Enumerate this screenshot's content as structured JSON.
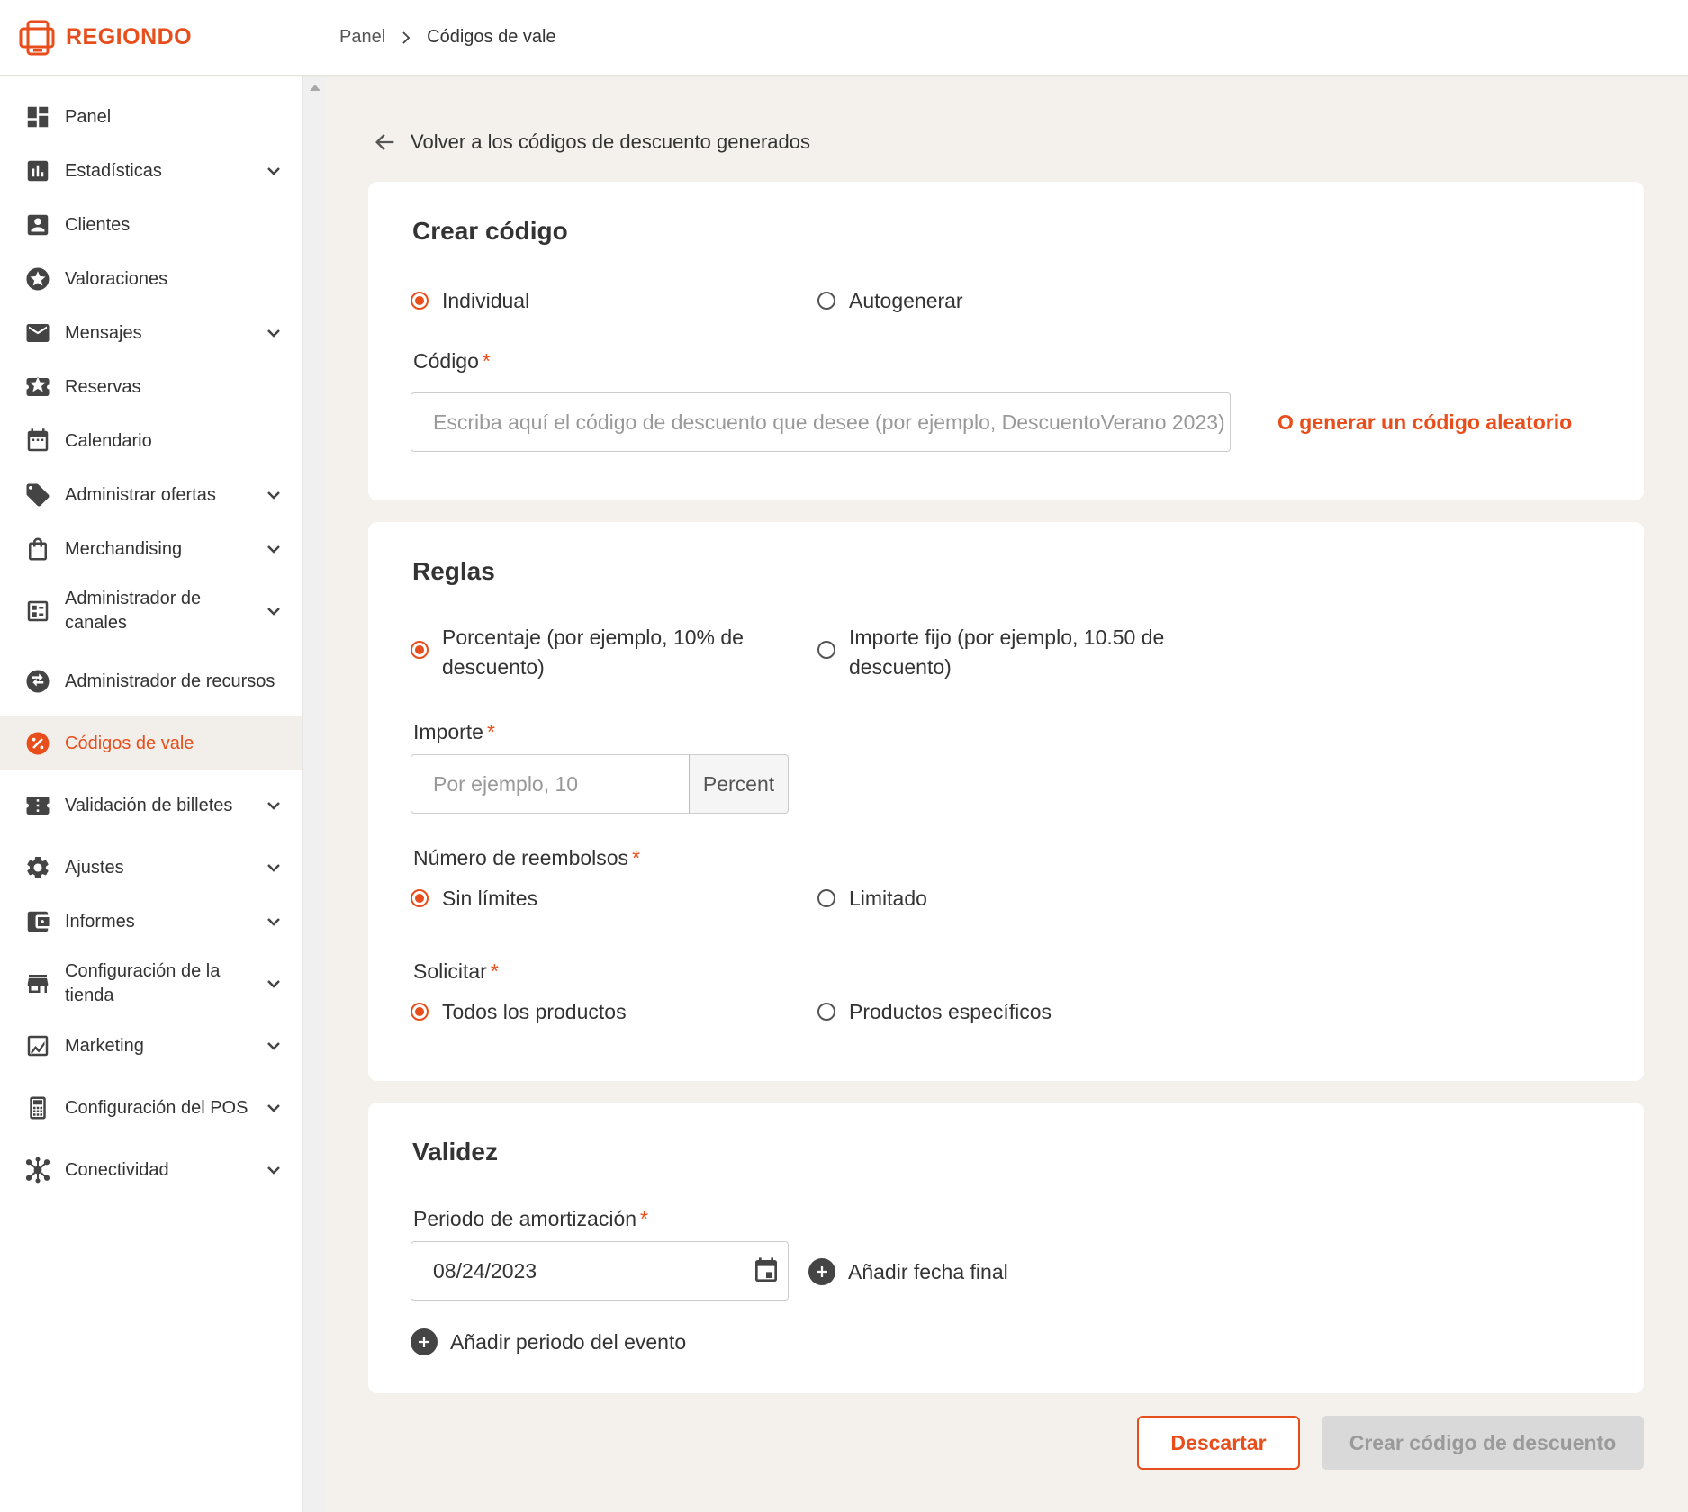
{
  "header": {
    "brand": "REGIONDO",
    "breadcrumb": {
      "parent": "Panel",
      "current": "Códigos de vale"
    }
  },
  "sidebar": {
    "items": [
      {
        "label": "Panel",
        "icon": "dashboard-icon"
      },
      {
        "label": "Estadísticas",
        "icon": "bar-chart-icon"
      },
      {
        "label": "Clientes",
        "icon": "person-icon"
      },
      {
        "label": "Valoraciones",
        "icon": "star-icon"
      },
      {
        "label": "Mensajes",
        "icon": "mail-icon"
      },
      {
        "label": "Reservas",
        "icon": "ticket-star-icon"
      },
      {
        "label": "Calendario",
        "icon": "calendar-icon"
      },
      {
        "label": "Administrar ofertas",
        "icon": "tag-icon"
      },
      {
        "label": "Merchandising",
        "icon": "shopping-bag-icon"
      },
      {
        "label": "Administrador de canales",
        "icon": "channel-icon"
      },
      {
        "label": "Administrador de recursos",
        "icon": "swap-icon"
      },
      {
        "label": "Códigos de vale",
        "icon": "percent-icon"
      },
      {
        "label": "Validación de billetes",
        "icon": "ticket-icon"
      },
      {
        "label": "Ajustes",
        "icon": "gear-icon"
      },
      {
        "label": "Informes",
        "icon": "wallet-icon"
      },
      {
        "label": "Configuración de la tienda",
        "icon": "store-icon"
      },
      {
        "label": "Marketing",
        "icon": "marketing-icon"
      },
      {
        "label": "Configuración del POS",
        "icon": "calculator-icon"
      },
      {
        "label": "Conectividad",
        "icon": "hub-icon"
      }
    ]
  },
  "main": {
    "back_link": "Volver a los códigos de descuento generados",
    "create": {
      "title": "Crear código",
      "options": [
        "Individual",
        "Autogenerar"
      ],
      "selected": "Individual",
      "code_label": "Código",
      "code_placeholder": "Escriba aquí el código de descuento que desee (por ejemplo, DescuentoVerano 2023)",
      "random_link": "O generar un código aleatorio"
    },
    "rules": {
      "title": "Reglas",
      "type_options": [
        "Porcentaje (por ejemplo, 10% de descuento)",
        "Importe fijo (por ejemplo, 10.50 de descuento)"
      ],
      "type_selected": "Porcentaje (por ejemplo, 10% de descuento)",
      "amount_label": "Importe",
      "amount_placeholder": "Por ejemplo, 10",
      "amount_addon": "Percent",
      "refunds_label": "Número de reembolsos",
      "refunds_options": [
        "Sin límites",
        "Limitado"
      ],
      "refunds_selected": "Sin límites",
      "apply_label": "Solicitar",
      "apply_options": [
        "Todos los productos",
        "Productos específicos"
      ],
      "apply_selected": "Todos los productos"
    },
    "validity": {
      "title": "Validez",
      "period_label": "Periodo de amortización",
      "date_value": "08/24/2023",
      "add_end_date": "Añadir fecha final",
      "add_event_period": "Añadir periodo del evento"
    },
    "actions": {
      "discard": "Descartar",
      "create": "Crear código de descuento"
    }
  },
  "colors": {
    "accent": "#e84e1b",
    "background": "#f4f0eb"
  }
}
